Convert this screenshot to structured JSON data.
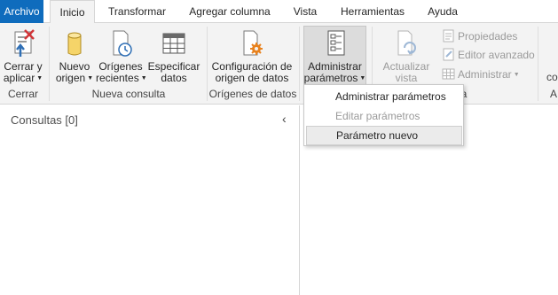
{
  "tabs": {
    "file": "Archivo",
    "home": "Inicio",
    "transform": "Transformar",
    "add_column": "Agregar columna",
    "view": "Vista",
    "tools": "Herramientas",
    "help": "Ayuda"
  },
  "ribbon": {
    "close_apply": {
      "line1": "Cerrar y",
      "line2": "aplicar",
      "icon": "close-apply-icon"
    },
    "group_close": "Cerrar",
    "new_source": {
      "line1": "Nuevo",
      "line2": "origen",
      "icon": "database-icon"
    },
    "recent_sources": {
      "line1": "Orígenes",
      "line2": "recientes",
      "icon": "recent-sources-icon"
    },
    "enter_data": {
      "line1": "Especificar",
      "line2": "datos",
      "icon": "table-icon"
    },
    "group_new_query": "Nueva consulta",
    "data_source_settings": {
      "line1": "Configuración de",
      "line2": "origen de datos",
      "icon": "data-source-settings-icon"
    },
    "group_data_sources": "Orígenes de datos",
    "manage_parameters": {
      "line1": "Administrar",
      "line2": "parámetros",
      "icon": "parameters-icon"
    },
    "refresh_preview": {
      "line1": "Actualizar",
      "line2": "vista previa",
      "icon": "refresh-icon"
    },
    "properties": "Propiedades",
    "advanced_editor": "Editor avanzado",
    "manage": "Administrar",
    "group_query_partial": "lta",
    "cut_label_co": "co",
    "cut_label_a": "A"
  },
  "menu": {
    "items": [
      {
        "label": "Administrar parámetros",
        "enabled": true
      },
      {
        "label": "Editar parámetros",
        "enabled": false
      },
      {
        "label": "Parámetro nuevo",
        "enabled": true,
        "hovered": true
      }
    ]
  },
  "queries": {
    "title": "Consultas [0]",
    "collapse_glyph": "‹"
  },
  "colors": {
    "file_tab": "#0f6cbd",
    "ribbon_bg": "#f3f3f3",
    "accent_orange": "#e8821e"
  }
}
